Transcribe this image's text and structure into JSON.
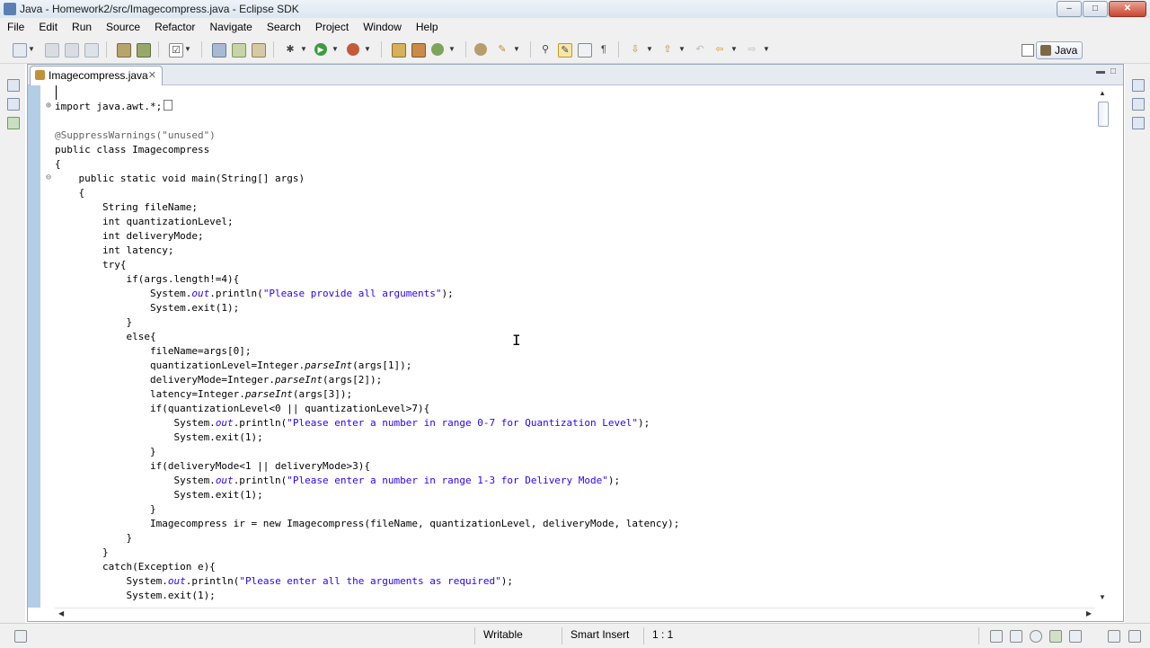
{
  "window": {
    "title": "Java - Homework2/src/Imagecompress.java - Eclipse SDK",
    "minimize_glyph": "–",
    "maximize_glyph": "□",
    "close_glyph": "✕"
  },
  "menu": [
    "File",
    "Edit",
    "Run",
    "Source",
    "Refactor",
    "Navigate",
    "Search",
    "Project",
    "Window",
    "Help"
  ],
  "toolbar": {
    "perspective_label": "Java"
  },
  "editor": {
    "tab_label": "Imagecompress.java",
    "tab_close": "✕",
    "code_lines": {
      "l2": "import java.awt.*;",
      "l4": "@SuppressWarnings(\"unused\")",
      "l5": "public class Imagecompress",
      "l6": "{",
      "l7": "    public static void main(String[] args)",
      "l8": "    {",
      "l9": "        String fileName;",
      "l10": "        int quantizationLevel;",
      "l11": "        int deliveryMode;",
      "l12": "        int latency;",
      "l13": "        try{",
      "l14": "            if(args.length!=4){",
      "l15a": "                System.",
      "l15b": "out",
      "l15c": ".println(",
      "l15d": "\"Please provide all arguments\"",
      "l15e": ");",
      "l16": "                System.exit(1);",
      "l17": "            }",
      "l18": "            else{",
      "l19": "                fileName=args[0];",
      "l20a": "                quantizationLevel=Integer.",
      "l20b": "parseInt",
      "l20c": "(args[1]);",
      "l21a": "                deliveryMode=Integer.",
      "l21b": "parseInt",
      "l21c": "(args[2]);",
      "l22a": "                latency=Integer.",
      "l22b": "parseInt",
      "l22c": "(args[3]);",
      "l23": "                if(quantizationLevel<0 || quantizationLevel>7){",
      "l24a": "                    System.",
      "l24b": "out",
      "l24c": ".println(",
      "l24d": "\"Please enter a number in range 0-7 for Quantization Level\"",
      "l24e": ");",
      "l25": "                    System.exit(1);",
      "l26": "                }",
      "l27": "                if(deliveryMode<1 || deliveryMode>3){",
      "l28a": "                    System.",
      "l28b": "out",
      "l28c": ".println(",
      "l28d": "\"Please enter a number in range 1-3 for Delivery Mode\"",
      "l28e": ");",
      "l29": "                    System.exit(1);",
      "l30": "                }",
      "l31": "                Imagecompress ir = new Imagecompress(fileName, quantizationLevel, deliveryMode, latency);",
      "l32": "            }",
      "l33": "        }",
      "l34": "        catch(Exception e){",
      "l35a": "            System.",
      "l35b": "out",
      "l35c": ".println(",
      "l35d": "\"Please enter all the arguments as required\"",
      "l35e": ");",
      "l36": "            System.exit(1);"
    }
  },
  "status": {
    "writable": "Writable",
    "insert_mode": "Smart Insert",
    "position": "1 : 1"
  },
  "colors": {
    "string": "#2a00ff",
    "annotation": "#646464",
    "ruler": "#b3cde6"
  }
}
